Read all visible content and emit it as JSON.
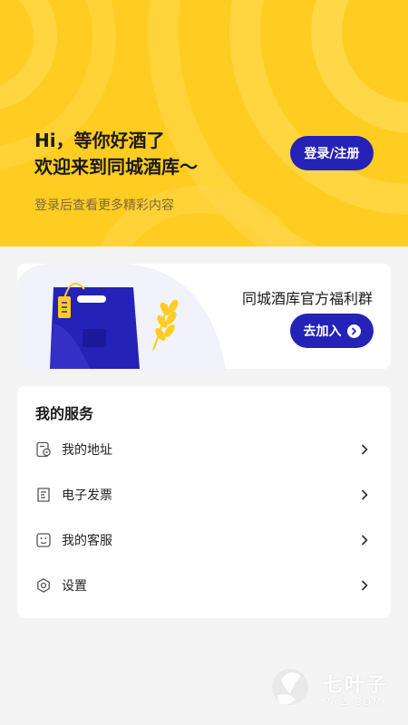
{
  "header": {
    "greeting_line1": "Hi，等你好酒了",
    "greeting_line2": "欢迎来到同城酒库～",
    "subtitle": "登录后查看更多精彩内容",
    "login_button": "登录/注册"
  },
  "welfare": {
    "title": "同城酒库官方福利群",
    "join_button": "去加入"
  },
  "services": {
    "title": "我的服务",
    "items": [
      {
        "label": "我的地址",
        "icon": "address-icon"
      },
      {
        "label": "电子发票",
        "icon": "invoice-icon"
      },
      {
        "label": "我的客服",
        "icon": "customer-service-icon"
      },
      {
        "label": "设置",
        "icon": "settings-icon"
      }
    ]
  },
  "watermark": {
    "text": "七叶子",
    "sub": "7YZ.COM"
  },
  "colors": {
    "header_bg": "#ffcc21",
    "accent": "#2522b8",
    "page_bg": "#f4f4f4"
  }
}
